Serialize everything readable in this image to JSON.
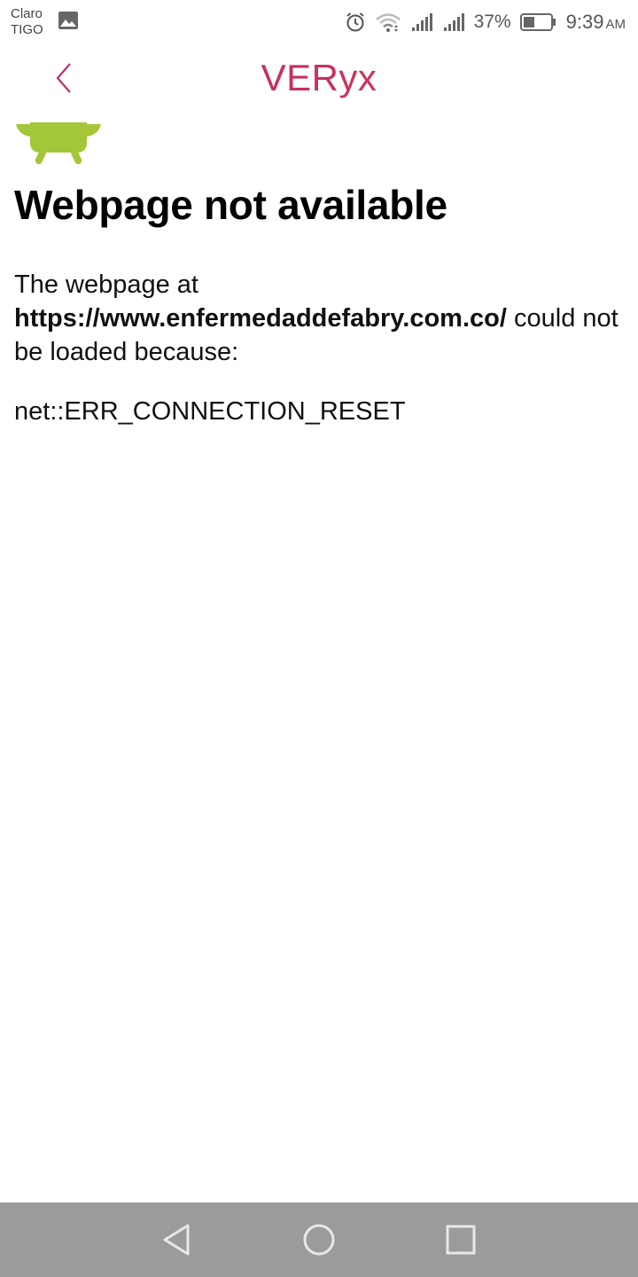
{
  "status_bar": {
    "carrier_line1": "Claro",
    "carrier_line2": "TIGO",
    "battery_percent": "37%",
    "time": "9:39",
    "am_pm": "AM",
    "icons": [
      "gallery-icon",
      "alarm-icon",
      "wifi-icon",
      "signal-icon",
      "signal-icon",
      "battery-icon"
    ]
  },
  "app_bar": {
    "title": "VERyx",
    "back_icon": "chevron-left-icon",
    "accent_color": "#b8306e"
  },
  "error_page": {
    "title": "Webpage not available",
    "body_prefix": "The webpage at",
    "url": "https://www.enfermedaddefabry.com.co/",
    "body_suffix": "could not be loaded because:",
    "error_code": "net::ERR_CONNECTION_RESET",
    "icon": "android-icon",
    "icon_color": "#a4c639"
  },
  "nav_bar": {
    "buttons": [
      "back-icon",
      "home-icon",
      "recents-icon"
    ],
    "background": "#9b9b9b"
  }
}
